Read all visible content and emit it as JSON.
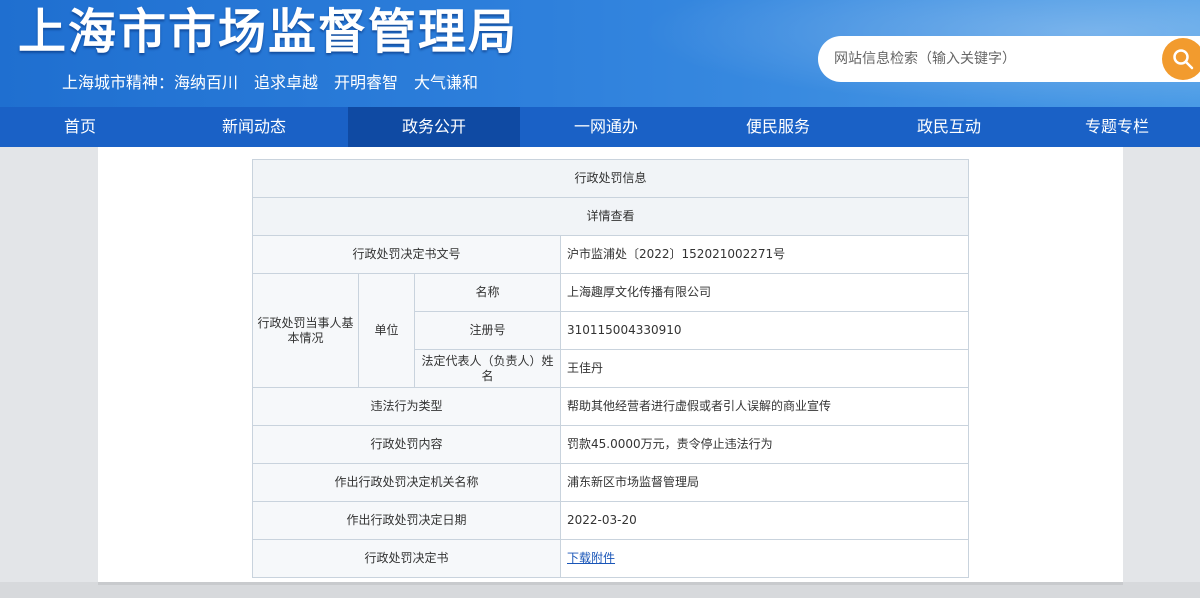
{
  "header": {
    "title": "上海市市场监督管理局",
    "slogan": "上海城市精神：海纳百川　追求卓越　开明睿智　大气谦和"
  },
  "search": {
    "placeholder": "网站信息检索（输入关键字）",
    "icon": "search-icon"
  },
  "nav": {
    "items": [
      {
        "label": "首页"
      },
      {
        "label": "新闻动态"
      },
      {
        "label": "政务公开"
      },
      {
        "label": "一网通办"
      },
      {
        "label": "便民服务"
      },
      {
        "label": "政民互动"
      },
      {
        "label": "专题专栏"
      }
    ],
    "active": "政务公开"
  },
  "table": {
    "title": "行政处罚信息",
    "subtitle": "详情查看",
    "rows": {
      "doc_no": {
        "label": "行政处罚决定书文号",
        "value": "沪市监浦处〔2022〕152021002271号"
      },
      "party": {
        "label": "行政处罚当事人基本情况",
        "type": "单位",
        "name": {
          "label": "名称",
          "value": "上海趣厚文化传播有限公司"
        },
        "reg_no": {
          "label": "注册号",
          "value": "310115004330910"
        },
        "legal_rep": {
          "label": "法定代表人（负责人）姓名",
          "value": "王佳丹"
        }
      },
      "violation_type": {
        "label": "违法行为类型",
        "value": "帮助其他经营者进行虚假或者引人误解的商业宣传"
      },
      "content": {
        "label": "行政处罚内容",
        "value": "罚款45.0000万元，责令停止违法行为"
      },
      "authority": {
        "label": "作出行政处罚决定机关名称",
        "value": "浦东新区市场监督管理局"
      },
      "date": {
        "label": "作出行政处罚决定日期",
        "value": "2022-03-20"
      },
      "document": {
        "label": "行政处罚决定书",
        "value": "下载附件"
      }
    }
  },
  "colors": {
    "header": "#1f6fd0",
    "nav": "#1a61c6",
    "nav_active": "#0f4aa3",
    "search_button": "#f29b2e",
    "link": "#1a56b8"
  }
}
